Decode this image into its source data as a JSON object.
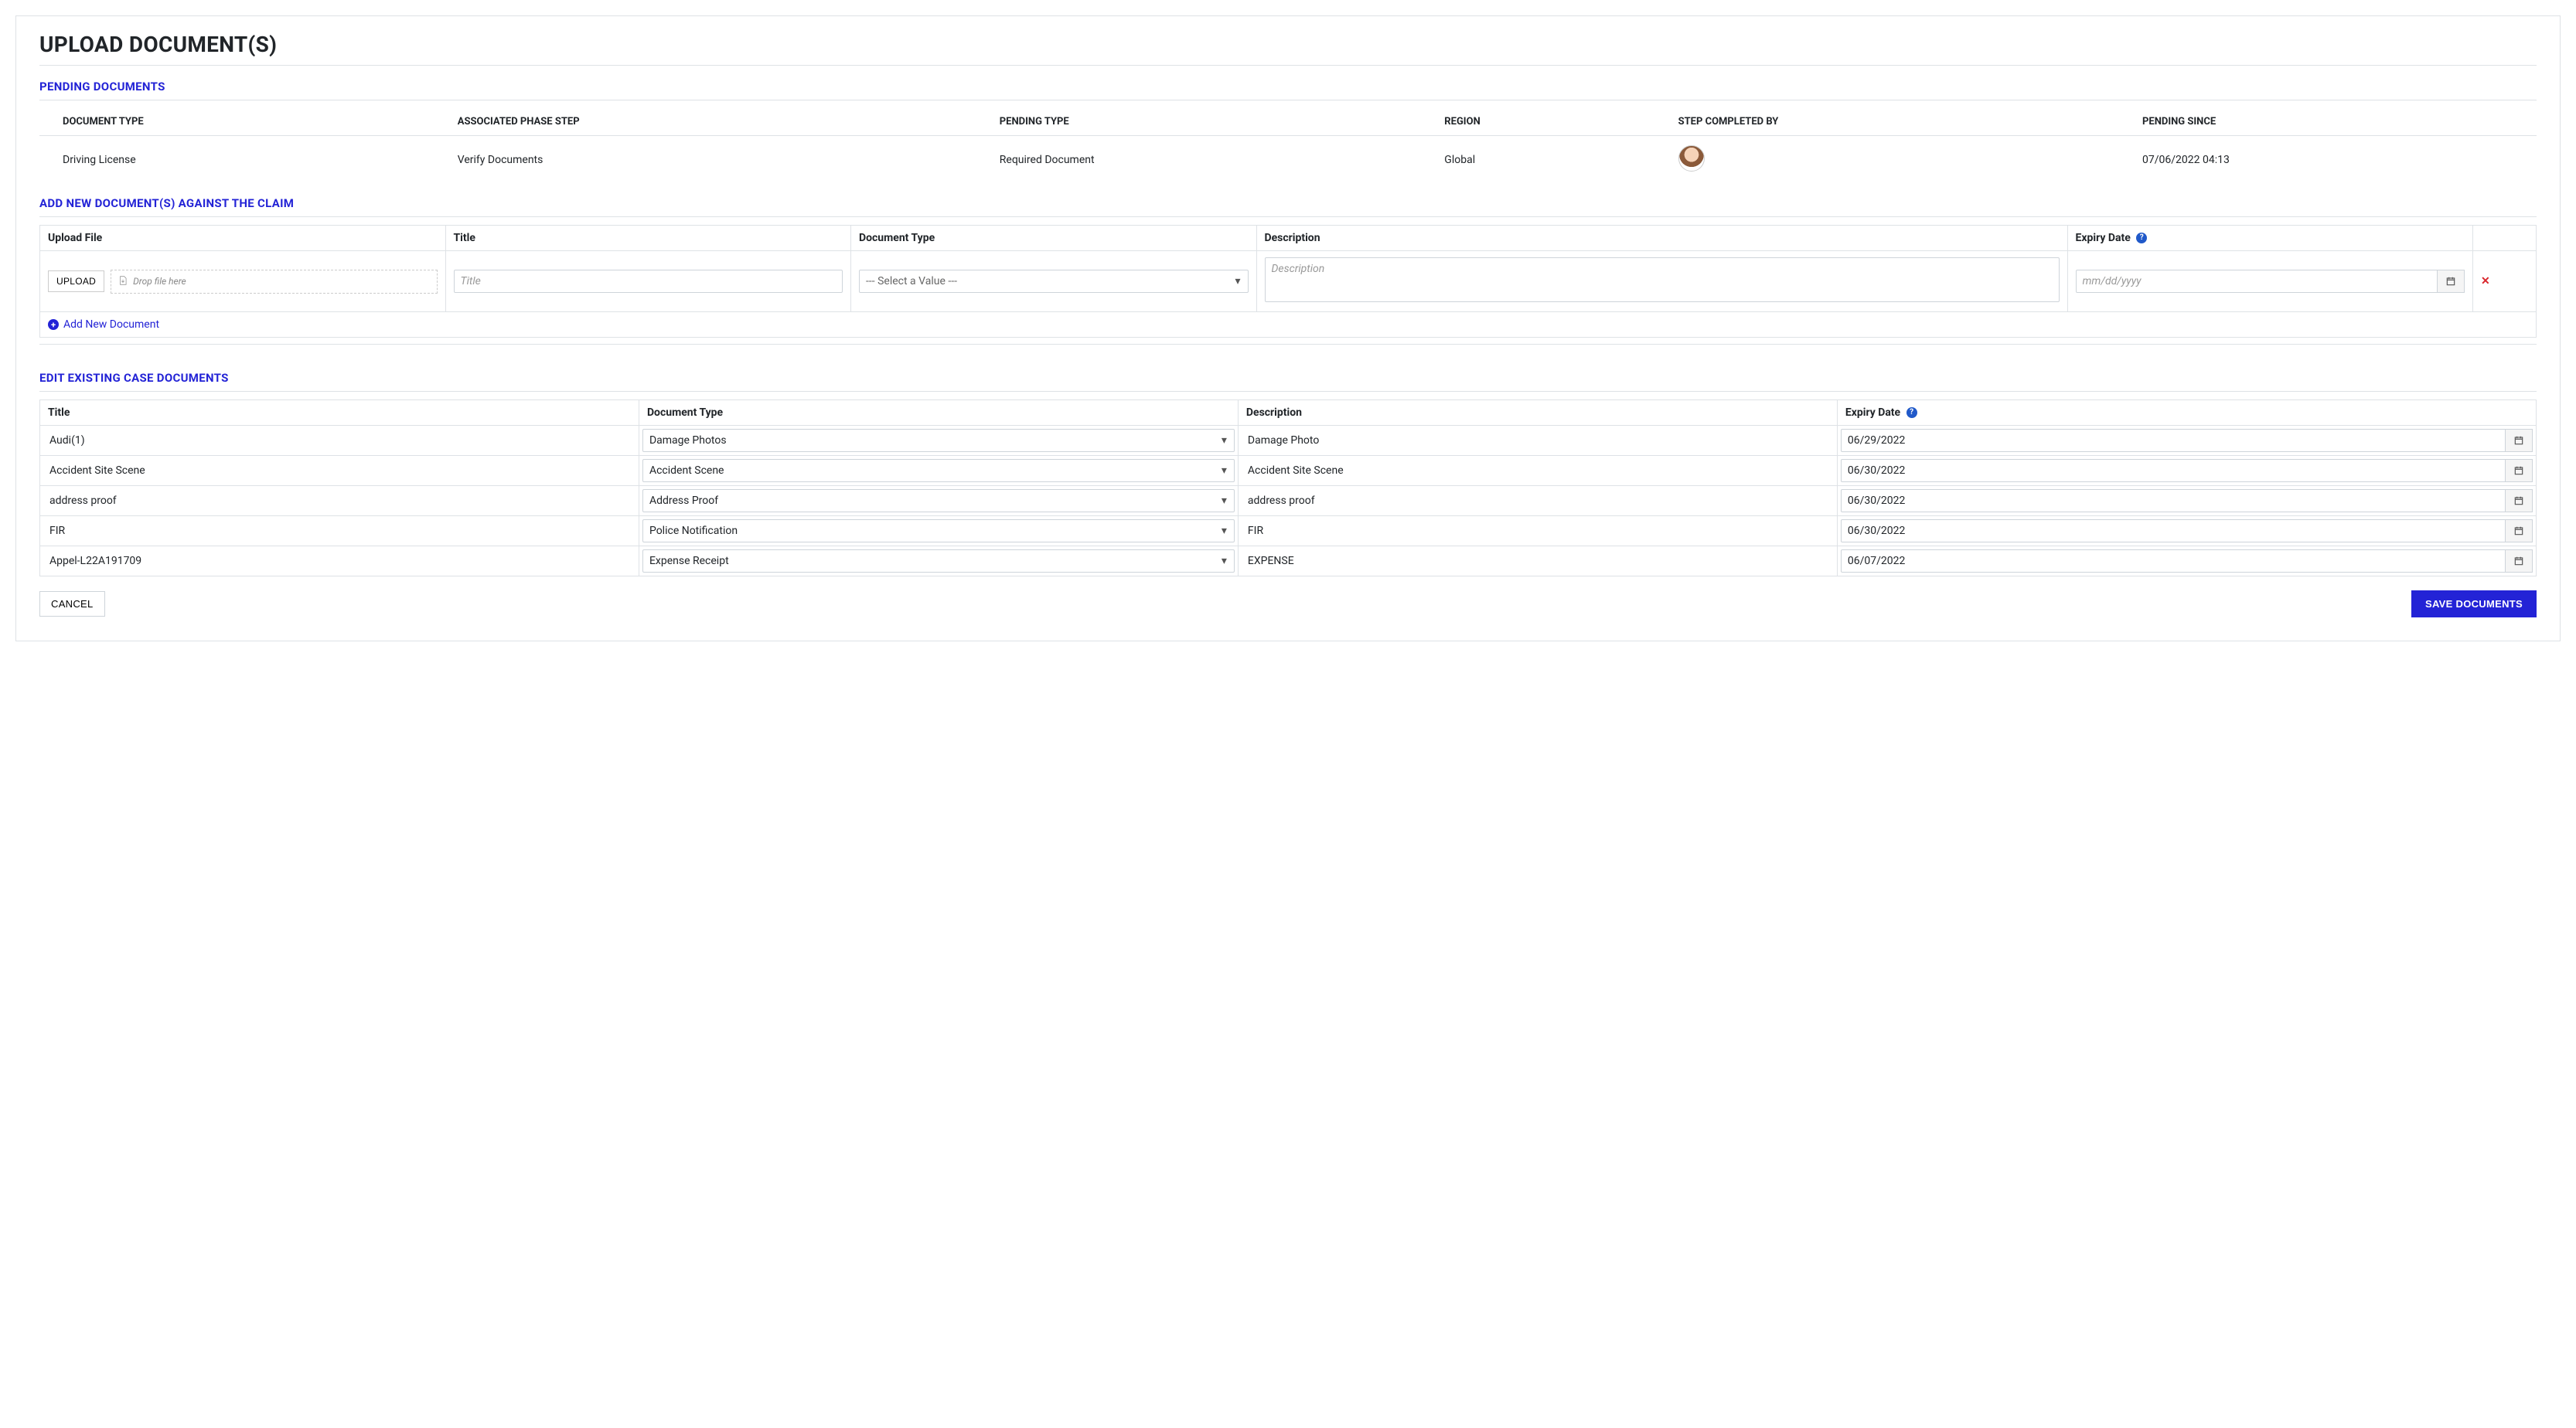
{
  "page_title": "UPLOAD DOCUMENT(S)",
  "sections": {
    "pending_title": "PENDING DOCUMENTS",
    "addnew_title": "ADD NEW DOCUMENT(S) AGAINST THE CLAIM",
    "existing_title": "EDIT EXISTING CASE DOCUMENTS"
  },
  "pending": {
    "headers": {
      "doc_type": "DOCUMENT TYPE",
      "phase": "ASSOCIATED PHASE STEP",
      "ptype": "PENDING TYPE",
      "region": "REGION",
      "completed_by": "STEP COMPLETED BY",
      "since": "PENDING SINCE"
    },
    "rows": [
      {
        "doc_type": "Driving License",
        "phase": "Verify Documents",
        "ptype": "Required Document",
        "region": "Global",
        "since": "07/06/2022 04:13"
      }
    ]
  },
  "addnew": {
    "headers": {
      "upload": "Upload File",
      "title": "Title",
      "doctype": "Document Type",
      "description": "Description",
      "expiry": "Expiry Date"
    },
    "upload_button": "UPLOAD",
    "drop_hint": "Drop file here",
    "title_placeholder": "Title",
    "doctype_placeholder": "--- Select a Value ---",
    "description_placeholder": "Description",
    "expiry_placeholder": "mm/dd/yyyy",
    "add_link": "Add New Document"
  },
  "existing": {
    "headers": {
      "title": "Title",
      "doctype": "Document Type",
      "description": "Description",
      "expiry": "Expiry Date"
    },
    "rows": [
      {
        "title": "Audi(1)",
        "doctype": "Damage Photos",
        "description": "Damage Photo",
        "expiry": "06/29/2022"
      },
      {
        "title": "Accident Site Scene",
        "doctype": "Accident Scene",
        "description": "Accident Site Scene",
        "expiry": "06/30/2022"
      },
      {
        "title": "address proof",
        "doctype": "Address Proof",
        "description": "address proof",
        "expiry": "06/30/2022"
      },
      {
        "title": "FIR",
        "doctype": "Police Notification",
        "description": "FIR",
        "expiry": "06/30/2022"
      },
      {
        "title": "Appel-L22A191709",
        "doctype": "Expense Receipt",
        "description": "EXPENSE",
        "expiry": "06/07/2022"
      }
    ]
  },
  "buttons": {
    "cancel": "CANCEL",
    "save": "SAVE DOCUMENTS"
  }
}
